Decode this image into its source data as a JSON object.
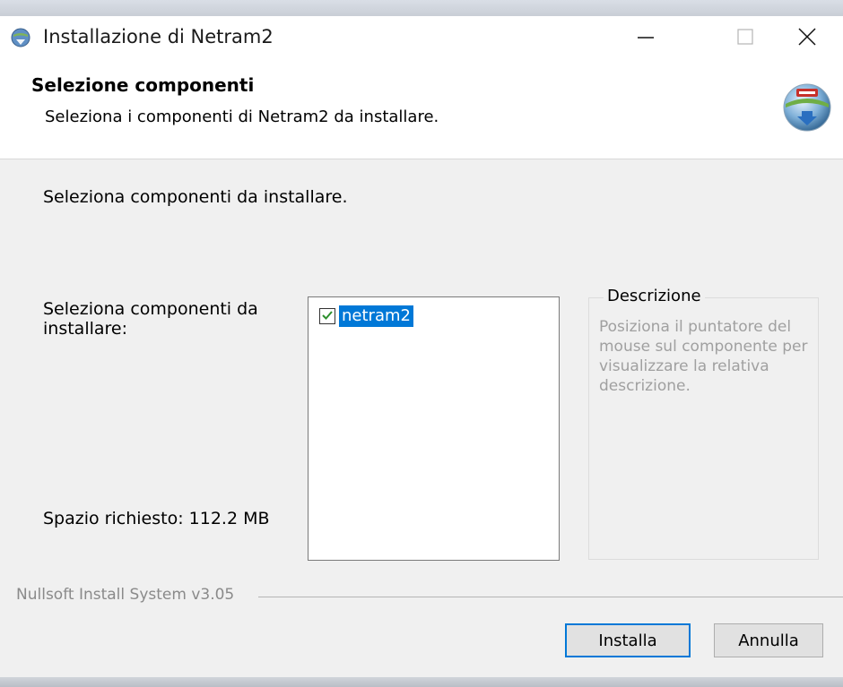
{
  "window": {
    "title": "Installazione di Netram2",
    "icon": "installer-globe-icon"
  },
  "header": {
    "title": "Selezione componenti",
    "subtitle": "Seleziona i componenti di Netram2 da installare."
  },
  "main": {
    "intro": "Seleziona componenti da installare.",
    "components_label": "Seleziona componenti da installare:",
    "space_required": "Spazio richiesto: 112.2 MB",
    "components": [
      {
        "label": "netram2",
        "checked": true
      }
    ],
    "description": {
      "legend": "Descrizione",
      "text": "Posiziona il puntatore del mouse sul componente per visualizzare  la relativa descrizione."
    }
  },
  "footer": {
    "branding": "Nullsoft Install System v3.05",
    "install_label": "Installa",
    "cancel_label": "Annulla"
  },
  "colors": {
    "selection": "#0078d7",
    "check": "#2d8f2d",
    "disabled_text": "#a0a0a0"
  }
}
